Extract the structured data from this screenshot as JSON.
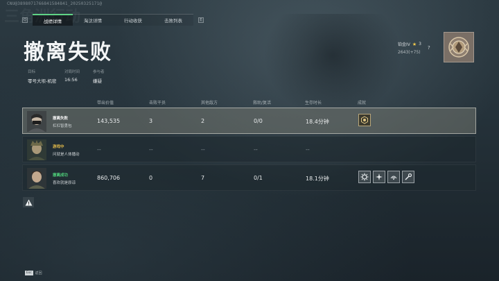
{
  "watermark": "CNU@3898071766841584841_20250325171@",
  "tabs": [
    {
      "label": "战绩详情",
      "active": true
    },
    {
      "label": "淘汰详情",
      "active": false
    },
    {
      "label": "行动收获",
      "active": false
    },
    {
      "label": "击败列表",
      "active": false
    }
  ],
  "tab_keys": {
    "left": "Q",
    "right": "E"
  },
  "title": "撤离失败",
  "info": {
    "target": {
      "label": "目标",
      "value": "零号大坝-机密"
    },
    "time": {
      "label": "对局时间",
      "value": "16:56"
    },
    "participant": {
      "label": "参与者",
      "value": "嫌疑"
    }
  },
  "rank": {
    "tier": "铂金IV",
    "stars": "3",
    "points": "2643(+75)",
    "help": "?"
  },
  "table": {
    "headers": [
      "带出价值",
      "击败干员",
      "其他敌方",
      "救助/复活",
      "生存时长",
      "成就"
    ],
    "rows": [
      {
        "status": "撤离失败",
        "status_color": "#f2f2f2",
        "name": "杠杠智勇包",
        "value": "143,535",
        "kills": "3",
        "others": "2",
        "rescue": "0/0",
        "survival": "18.4分钟",
        "achievements": [
          "gold-hexagon-icon"
        ]
      },
      {
        "status": "游戏中",
        "status_color": "#e0b84a",
        "name": "问就是人体播动",
        "value": "--",
        "kills": "--",
        "others": "--",
        "rescue": "--",
        "survival": "--",
        "achievements": []
      },
      {
        "status": "撤离成功",
        "status_color": "#4fd07a",
        "name": "喜欢就是原谅",
        "value": "860,706",
        "kills": "0",
        "others": "7",
        "rescue": "0/1",
        "survival": "18.1分钟",
        "achievements": [
          "gear-icon",
          "star-burst-icon",
          "radar-icon",
          "wrench-icon"
        ]
      }
    ]
  },
  "footer": {
    "key": "Esc",
    "label": "返回"
  },
  "colors": {
    "accent_green": "#5fd486",
    "in_game_yellow": "#e0b84a",
    "success_green": "#4fd07a"
  }
}
